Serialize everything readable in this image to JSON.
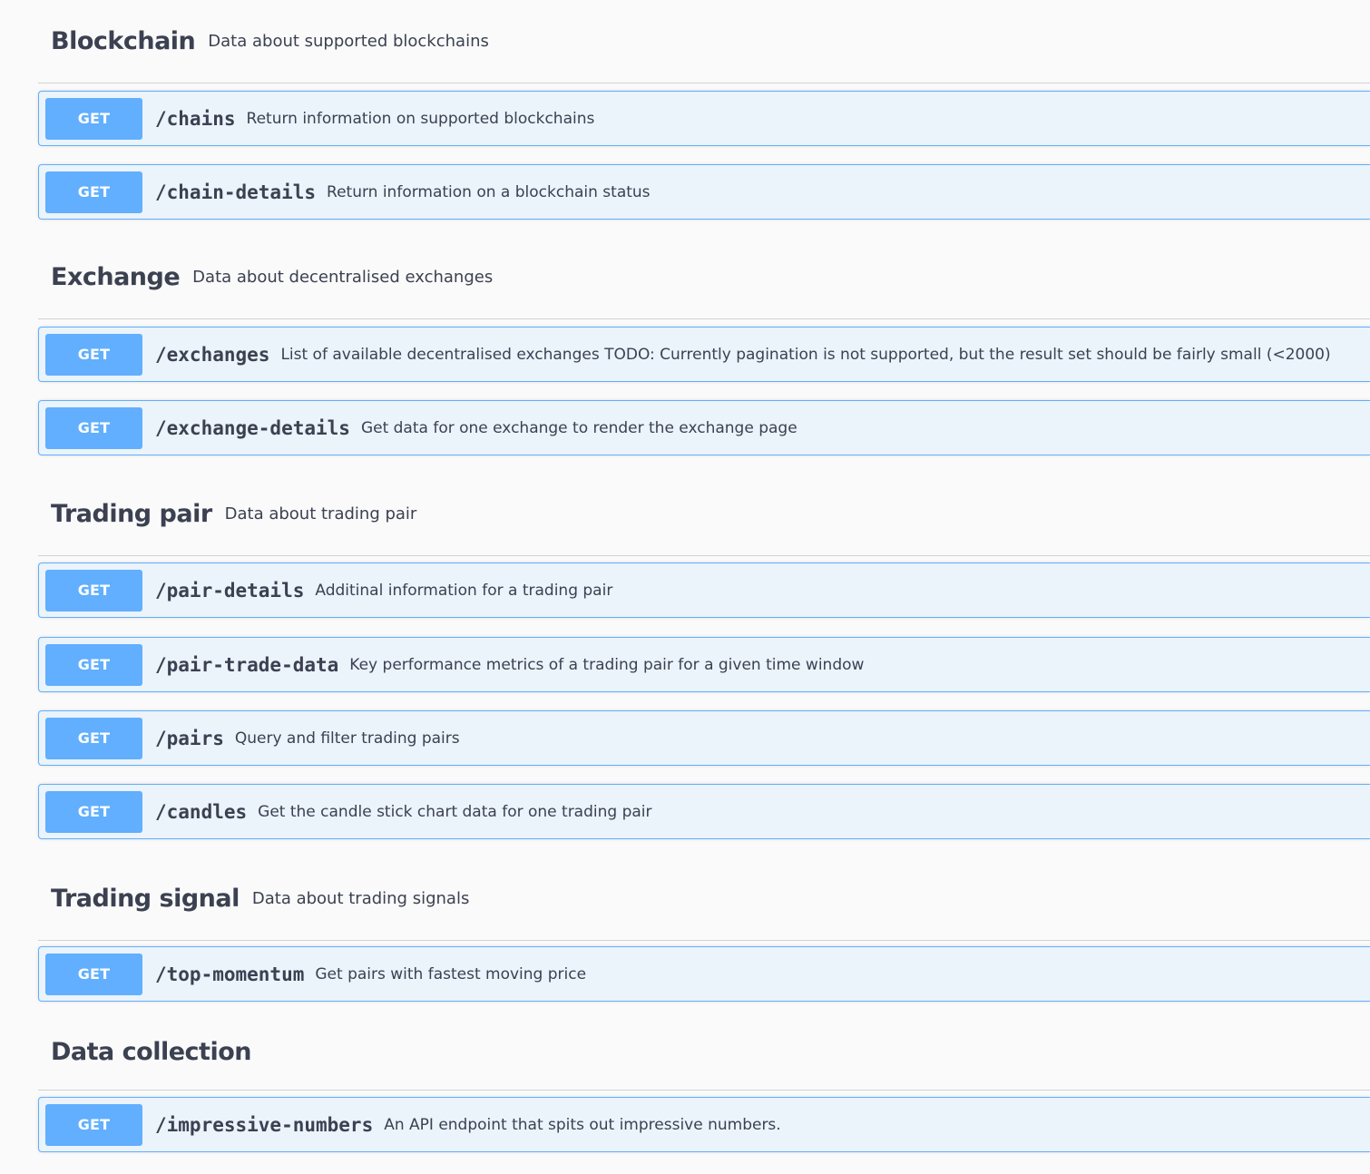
{
  "sections": [
    {
      "title": "Blockchain",
      "description": "Data about supported blockchains",
      "operations": [
        {
          "method": "GET",
          "path": "/chains",
          "summary": "Return information on supported blockchains"
        },
        {
          "method": "GET",
          "path": "/chain-details",
          "summary": "Return information on a blockchain status"
        }
      ]
    },
    {
      "title": "Exchange",
      "description": "Data about decentralised exchanges",
      "operations": [
        {
          "method": "GET",
          "path": "/exchanges",
          "summary": "List of available decentralised exchanges TODO: Currently pagination is not supported, but the result set should be fairly small (<2000)"
        },
        {
          "method": "GET",
          "path": "/exchange-details",
          "summary": "Get data for one exchange to render the exchange page"
        }
      ]
    },
    {
      "title": "Trading pair",
      "description": "Data about trading pair",
      "operations": [
        {
          "method": "GET",
          "path": "/pair-details",
          "summary": "Additinal information for a trading pair"
        },
        {
          "method": "GET",
          "path": "/pair-trade-data",
          "summary": "Key performance metrics of a trading pair for a given time window"
        },
        {
          "method": "GET",
          "path": "/pairs",
          "summary": "Query and filter trading pairs"
        },
        {
          "method": "GET",
          "path": "/candles",
          "summary": "Get the candle stick chart data for one trading pair"
        }
      ]
    },
    {
      "title": "Trading signal",
      "description": "Data about trading signals",
      "operations": [
        {
          "method": "GET",
          "path": "/top-momentum",
          "summary": "Get pairs with fastest moving price"
        }
      ]
    },
    {
      "title": "Data collection",
      "description": "",
      "operations": [
        {
          "method": "GET",
          "path": "/impressive-numbers",
          "summary": "An API endpoint that spits out impressive numbers."
        }
      ]
    }
  ],
  "colors": {
    "get_method": "#61affe",
    "get_background": "#ebf3fb",
    "text": "#3b4151"
  }
}
